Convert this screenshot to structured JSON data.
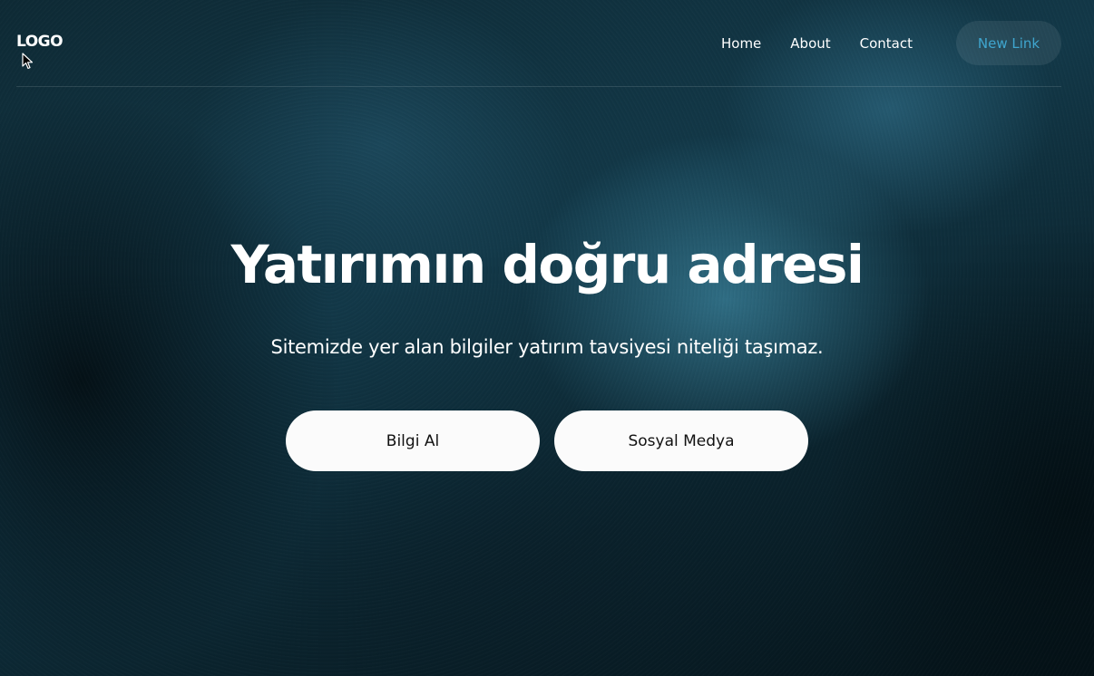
{
  "navbar": {
    "logo": "LOGO",
    "links": [
      {
        "label": "Home"
      },
      {
        "label": "About"
      },
      {
        "label": "Contact"
      }
    ],
    "cta_label": "New Link"
  },
  "hero": {
    "title": "Yatırımın doğru adresi",
    "subtitle": "Sitemizde yer alan bilgiler yatırım tavsiyesi niteliği taşımaz.",
    "buttons": [
      {
        "label": "Bilgi Al"
      },
      {
        "label": "Sosyal Medya"
      }
    ]
  },
  "colors": {
    "background": "#0e2a35",
    "accent_link": "#3fa6cf",
    "button_bg": "#fbfbfb",
    "button_text": "#111111"
  },
  "icons": {
    "cursor": "mouse-pointer-icon"
  }
}
